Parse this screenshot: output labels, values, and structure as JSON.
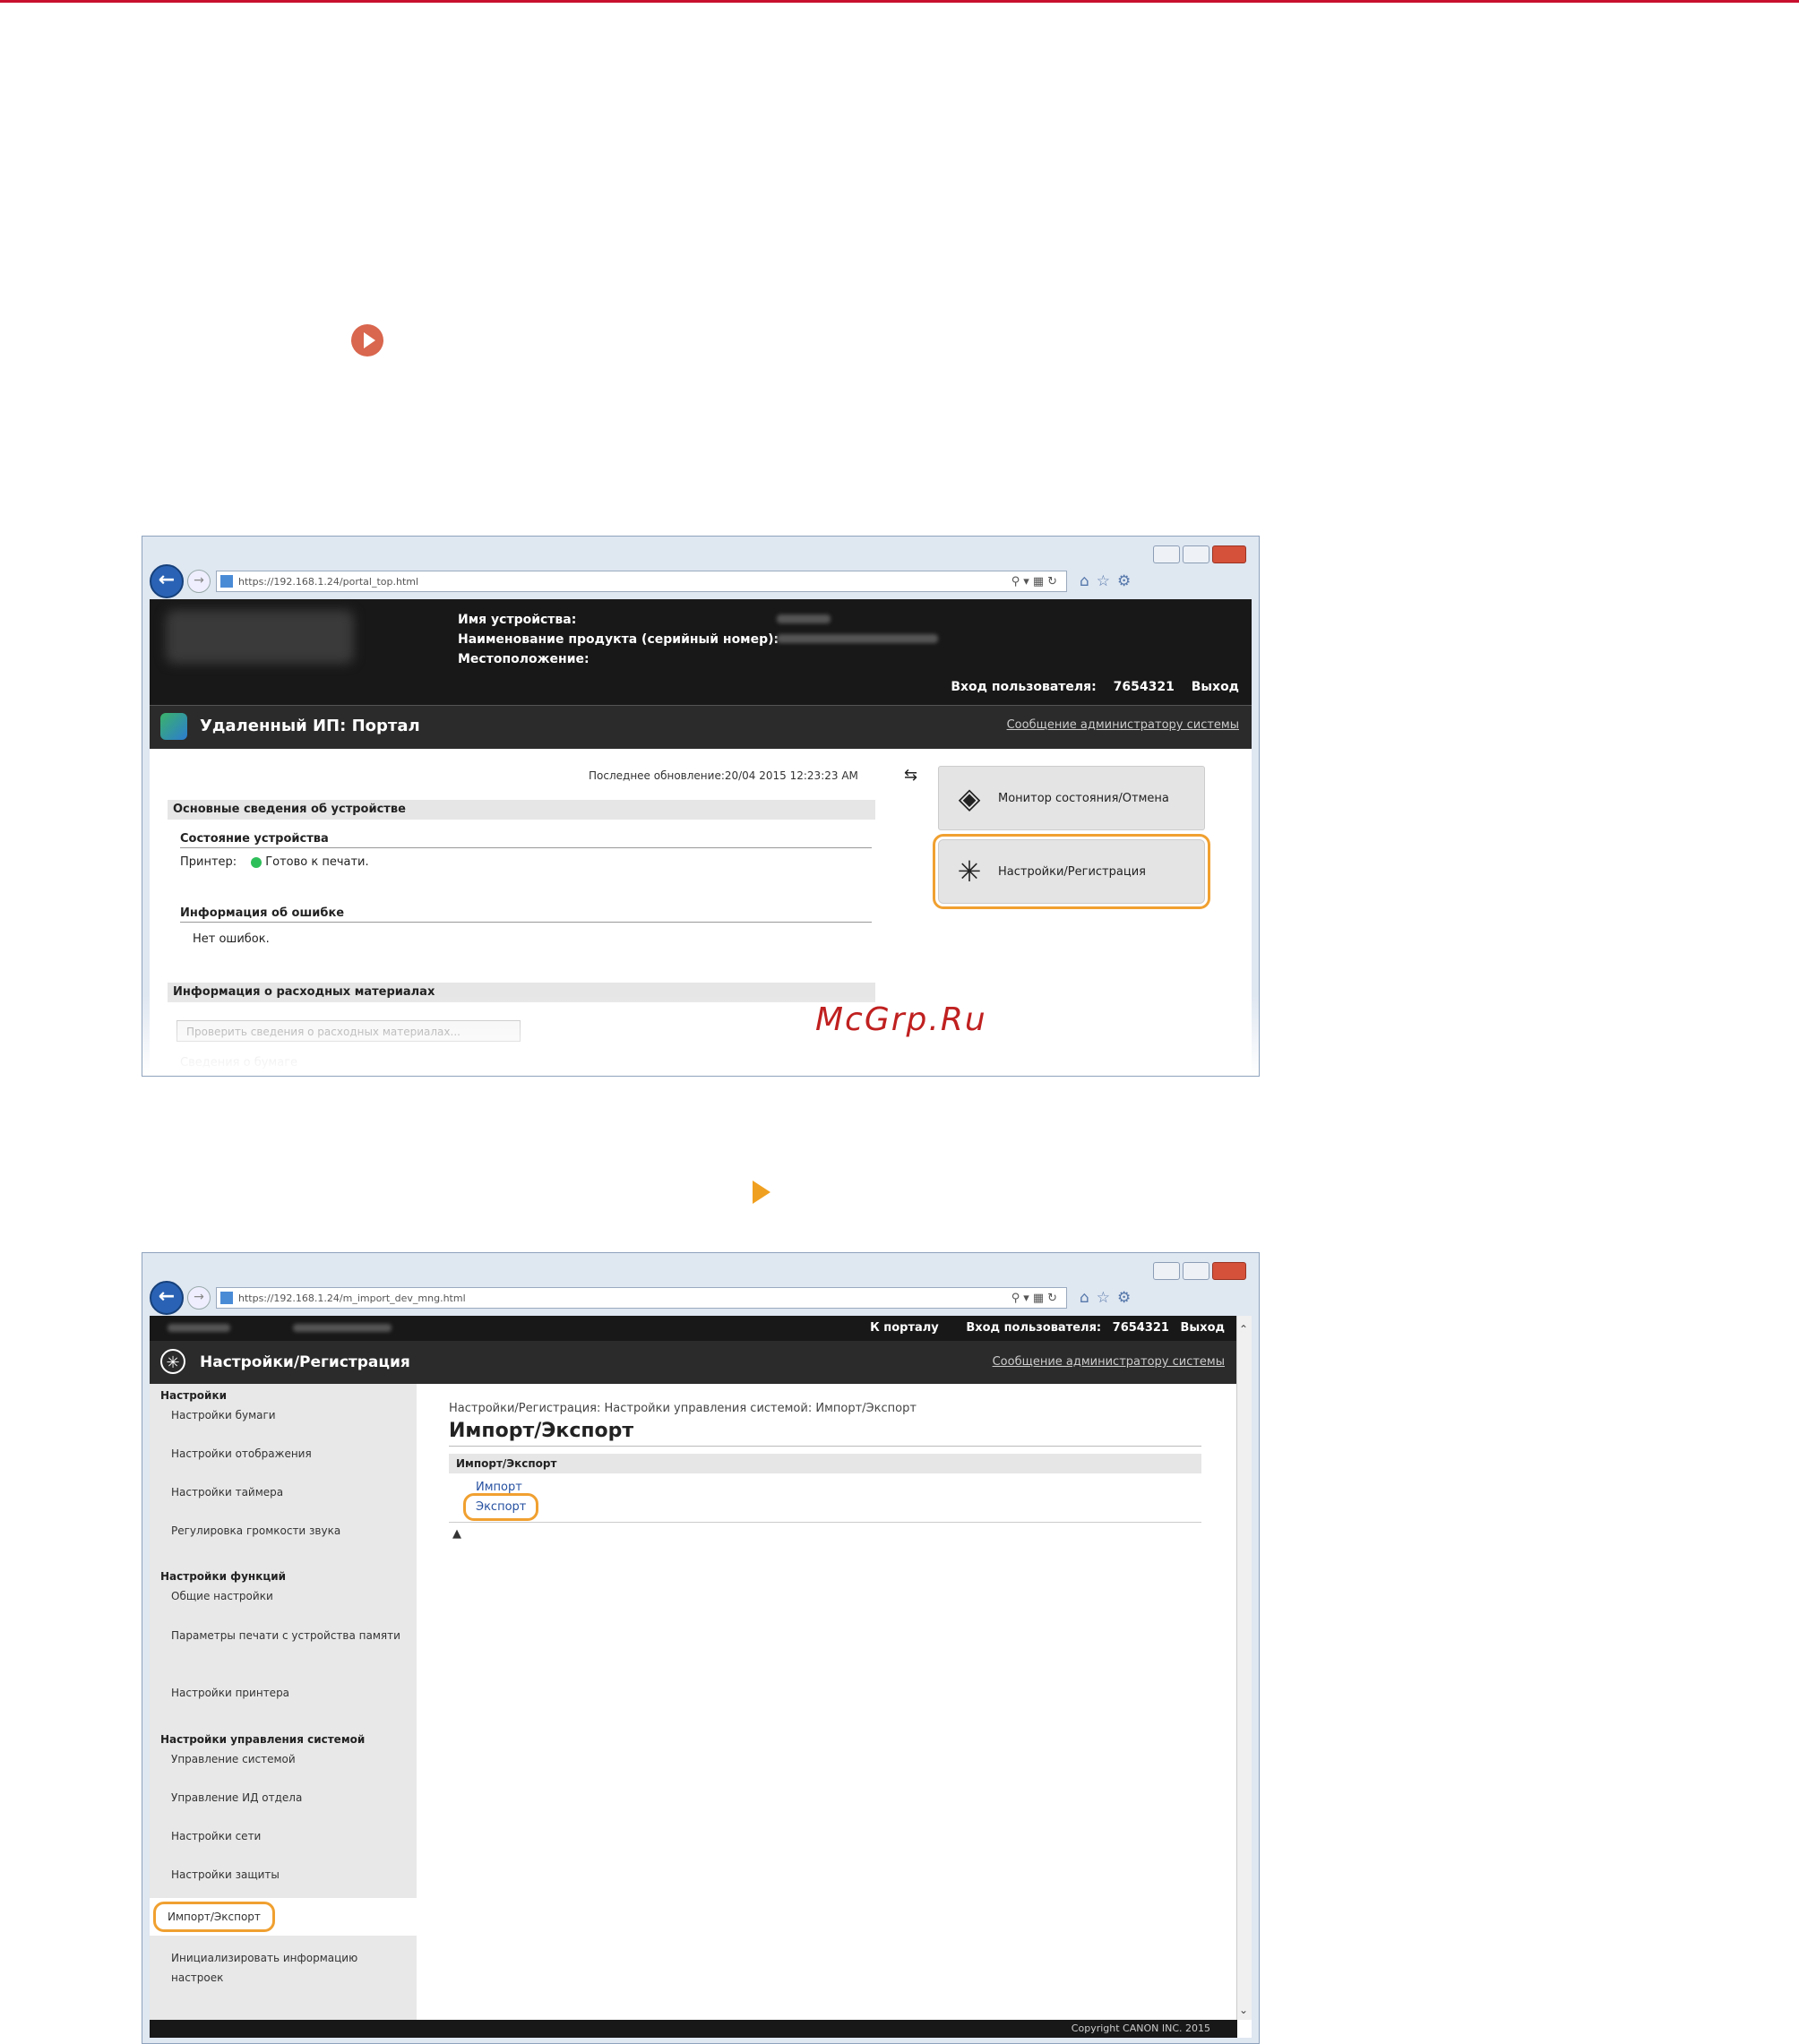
{
  "window1": {
    "url": "https://192.168.1.24/portal_top.html",
    "header": {
      "device_name_label": "Имя устройства:",
      "product_name_label": "Наименование продукта (серийный номер):",
      "location_label": "Местоположение:",
      "user_login_label": "Вход пользователя:",
      "user_id": "7654321",
      "logout": "Выход"
    },
    "title": "Удаленный ИП: Портал",
    "admin_message": "Сообщение администратору системы",
    "last_update": "Последнее обновление:20/04 2015 12:23:23 AM",
    "basic_info_header": "Основные сведения об устройстве",
    "device_status_header": "Состояние устройства",
    "printer_label": "Принтер:",
    "printer_status": "Готово к печати.",
    "error_info_header": "Информация об ошибке",
    "error_text": "Нет ошибок.",
    "consumables_header": "Информация о расходных материалах",
    "check_consumables_button": "Проверить сведения о расходных материалах...",
    "paper_info": "Сведения о бумаге",
    "status_monitor_button": "Монитор состояния/Отмена",
    "settings_button": "Настройки/Регистрация"
  },
  "watermark": "McGrp.Ru",
  "window2": {
    "url": "https://192.168.1.24/m_import_dev_mng.html",
    "to_portal": "К порталу",
    "user_login_label": "Вход пользователя:",
    "user_id": "7654321",
    "logout": "Выход",
    "title": "Настройки/Регистрация",
    "admin_message": "Сообщение администратору системы",
    "sidebar": {
      "group1": "Настройки",
      "group1_items": [
        "Настройки бумаги",
        "Настройки отображения",
        "Настройки таймера",
        "Регулировка громкости звука"
      ],
      "group2": "Настройки функций",
      "group2_items": [
        "Общие настройки",
        "Параметры печати с устройства памяти",
        "Настройки принтера"
      ],
      "group3": "Настройки управления системой",
      "group3_items": [
        "Управление системой",
        "Управление ИД отдела",
        "Настройки сети",
        "Настройки защиты",
        "Импорт/Экспорт",
        "Инициализировать информацию настроек"
      ]
    },
    "breadcrumb": "Настройки/Регистрация: Настройки управления системой: Импорт/Экспорт",
    "heading": "Импорт/Экспорт",
    "section": "Импорт/Экспорт",
    "import_link": "Импорт",
    "export_link": "Экспорт",
    "copyright": "Copyright CANON INC. 2015"
  },
  "colors": {
    "highlight": "#f0a030",
    "header_bg": "#181818",
    "accent_line": "#c8102e"
  }
}
